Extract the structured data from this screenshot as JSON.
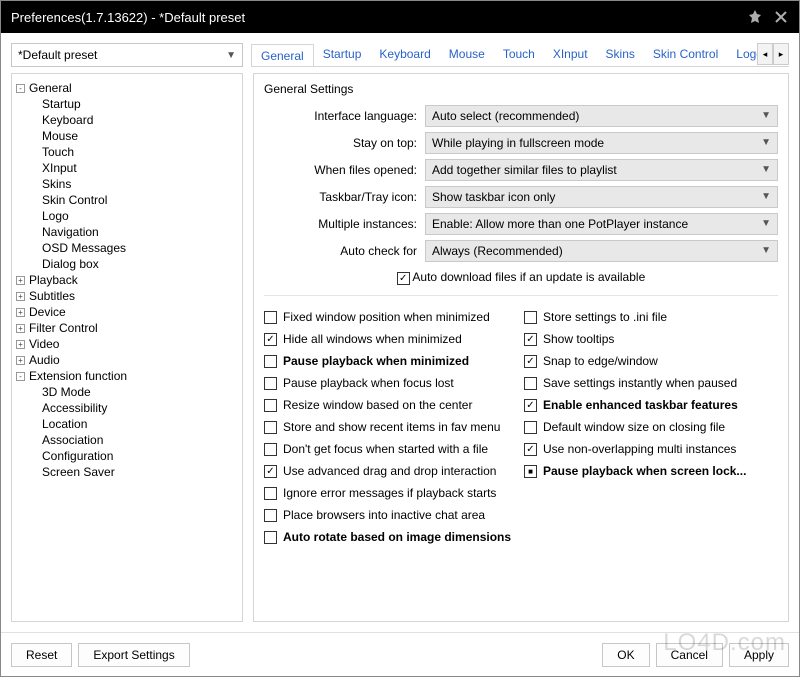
{
  "title": "Preferences(1.7.13622) - *Default preset",
  "preset": "*Default preset",
  "tabs": [
    "General",
    "Startup",
    "Keyboard",
    "Mouse",
    "Touch",
    "XInput",
    "Skins",
    "Skin Control",
    "Logo"
  ],
  "active_tab": 0,
  "tree": {
    "root": "General",
    "general_children": [
      "Startup",
      "Keyboard",
      "Mouse",
      "Touch",
      "XInput",
      "Skins",
      "Skin Control",
      "Logo",
      "Navigation",
      "OSD Messages",
      "Dialog box"
    ],
    "groups": [
      "Playback",
      "Subtitles",
      "Device",
      "Filter Control",
      "Video",
      "Audio",
      "Extension function"
    ],
    "ext_children": [
      "3D Mode",
      "Accessibility",
      "Location",
      "Association",
      "Configuration",
      "Screen Saver"
    ]
  },
  "section": "General Settings",
  "opts": {
    "lang_label": "Interface language:",
    "lang_value": "Auto select (recommended)",
    "stay_label": "Stay on top:",
    "stay_value": "While playing in fullscreen mode",
    "open_label": "When files opened:",
    "open_value": "Add together similar files to playlist",
    "tray_label": "Taskbar/Tray icon:",
    "tray_value": "Show taskbar icon only",
    "multi_label": "Multiple instances:",
    "multi_value": "Enable: Allow more than one PotPlayer instance",
    "update_label": "Auto check for",
    "update_value": "Always (Recommended)"
  },
  "auto_dl": "Auto download files if an update is available",
  "checks_left": [
    {
      "label": "Fixed window position when minimized",
      "state": ""
    },
    {
      "label": "Hide all windows when minimized",
      "state": "checked"
    },
    {
      "label": "Pause playback when minimized",
      "state": "",
      "bold": true
    },
    {
      "label": "Pause playback when focus lost",
      "state": ""
    },
    {
      "label": "Resize window based on the center",
      "state": ""
    },
    {
      "label": "Store and show recent items in fav menu",
      "state": ""
    },
    {
      "label": "Don't get focus when started with a file",
      "state": ""
    },
    {
      "label": "Use advanced drag and drop interaction",
      "state": "checked"
    },
    {
      "label": "Ignore error messages if playback starts",
      "state": ""
    },
    {
      "label": "Place browsers into inactive chat area",
      "state": ""
    },
    {
      "label": "Auto rotate based on image dimensions",
      "state": "",
      "bold": true
    }
  ],
  "checks_right": [
    {
      "label": "Store settings to .ini file",
      "state": ""
    },
    {
      "label": "Show tooltips",
      "state": "checked"
    },
    {
      "label": "Snap to edge/window",
      "state": "checked"
    },
    {
      "label": "Save settings instantly when paused",
      "state": ""
    },
    {
      "label": "Enable enhanced taskbar features",
      "state": "checked",
      "bold": true
    },
    {
      "label": "Default window size on closing file",
      "state": ""
    },
    {
      "label": "Use non-overlapping multi instances",
      "state": "checked"
    },
    {
      "label": "Pause playback when screen lock...",
      "state": "mixed",
      "bold": true
    }
  ],
  "footer": {
    "reset": "Reset",
    "export": "Export Settings",
    "ok": "OK",
    "cancel": "Cancel",
    "apply": "Apply"
  },
  "watermark": "LO4D.com"
}
